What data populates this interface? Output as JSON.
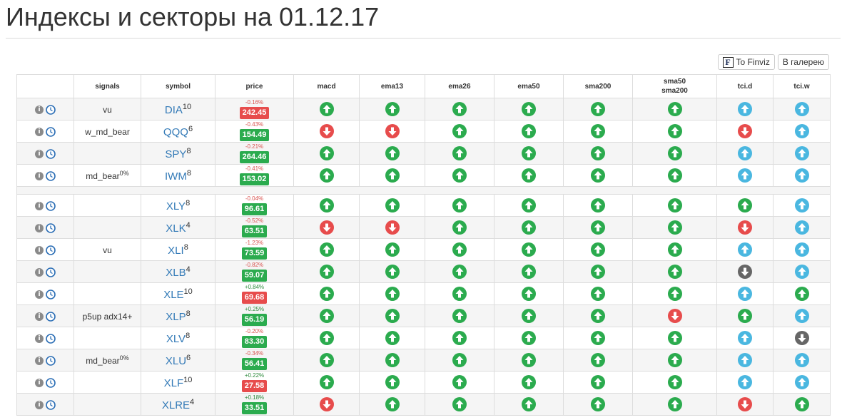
{
  "page": {
    "title": "Индексы и секторы на 01.12.17"
  },
  "toolbar": {
    "finviz_logo": "F",
    "finviz_label": "To Finviz",
    "gallery_label": "В галерею"
  },
  "colors": {
    "green": "#2bab4e",
    "red": "#e74c4c",
    "blue": "#4ab7e0",
    "gray": "#666666"
  },
  "table": {
    "columns": {
      "signals": "signals",
      "symbol": "symbol",
      "price": "price",
      "macd": "macd",
      "ema13": "ema13",
      "ema26": "ema26",
      "ema50": "ema50",
      "sma200": "sma200",
      "sma50_sma200_line1": "sma50",
      "sma50_sma200_line2": "sma200",
      "tci_d": "tci.d",
      "tci_w": "tci.w"
    },
    "groups": [
      {
        "rows": [
          {
            "signal": "vu",
            "signal_sup": "",
            "symbol": "DIA",
            "sup": "10",
            "change": "-0.16%",
            "price": "242.45",
            "price_color": "red",
            "signals": [
              "green-up",
              "green-up",
              "green-up",
              "green-up",
              "green-up",
              "green-up",
              "blue-up",
              "blue-up"
            ]
          },
          {
            "signal": "w_md_bear",
            "signal_sup": "",
            "symbol": "QQQ",
            "sup": "6",
            "change": "-0.43%",
            "price": "154.49",
            "price_color": "green",
            "signals": [
              "red-down",
              "red-down",
              "green-up",
              "green-up",
              "green-up",
              "green-up",
              "red-down",
              "blue-up"
            ]
          },
          {
            "signal": "",
            "signal_sup": "",
            "symbol": "SPY",
            "sup": "8",
            "change": "-0.21%",
            "price": "264.46",
            "price_color": "green",
            "signals": [
              "green-up",
              "green-up",
              "green-up",
              "green-up",
              "green-up",
              "green-up",
              "blue-up",
              "blue-up"
            ]
          },
          {
            "signal": "md_bear",
            "signal_sup": "0%",
            "symbol": "IWM",
            "sup": "8",
            "change": "-0.41%",
            "price": "153.02",
            "price_color": "green",
            "signals": [
              "green-up",
              "green-up",
              "green-up",
              "green-up",
              "green-up",
              "green-up",
              "blue-up",
              "blue-up"
            ]
          }
        ]
      },
      {
        "rows": [
          {
            "signal": "",
            "signal_sup": "",
            "symbol": "XLY",
            "sup": "8",
            "change": "-0.04%",
            "price": "96.61",
            "price_color": "green",
            "signals": [
              "green-up",
              "green-up",
              "green-up",
              "green-up",
              "green-up",
              "green-up",
              "green-up",
              "blue-up"
            ]
          },
          {
            "signal": "",
            "signal_sup": "",
            "symbol": "XLK",
            "sup": "4",
            "change": "-0.52%",
            "price": "63.51",
            "price_color": "green",
            "signals": [
              "red-down",
              "red-down",
              "green-up",
              "green-up",
              "green-up",
              "green-up",
              "red-down",
              "blue-up"
            ]
          },
          {
            "signal": "vu",
            "signal_sup": "",
            "symbol": "XLI",
            "sup": "8",
            "change": "-1.23%",
            "price": "73.59",
            "price_color": "green",
            "signals": [
              "green-up",
              "green-up",
              "green-up",
              "green-up",
              "green-up",
              "green-up",
              "blue-up",
              "blue-up"
            ]
          },
          {
            "signal": "",
            "signal_sup": "",
            "symbol": "XLB",
            "sup": "4",
            "change": "-0.82%",
            "price": "59.07",
            "price_color": "green",
            "signals": [
              "green-up",
              "green-up",
              "green-up",
              "green-up",
              "green-up",
              "green-up",
              "gray-down",
              "blue-up"
            ]
          },
          {
            "signal": "",
            "signal_sup": "",
            "symbol": "XLE",
            "sup": "10",
            "change": "+0.84%",
            "price": "69.68",
            "price_color": "red",
            "signals": [
              "green-up",
              "green-up",
              "green-up",
              "green-up",
              "green-up",
              "green-up",
              "blue-up",
              "green-up"
            ]
          },
          {
            "signal": "p5up adx14+",
            "signal_sup": "",
            "symbol": "XLP",
            "sup": "8",
            "change": "+0.25%",
            "price": "56.19",
            "price_color": "green",
            "signals": [
              "green-up",
              "green-up",
              "green-up",
              "green-up",
              "green-up",
              "red-down",
              "green-up",
              "blue-up"
            ]
          },
          {
            "signal": "",
            "signal_sup": "",
            "symbol": "XLV",
            "sup": "8",
            "change": "-0.20%",
            "price": "83.30",
            "price_color": "green",
            "signals": [
              "green-up",
              "green-up",
              "green-up",
              "green-up",
              "green-up",
              "green-up",
              "blue-up",
              "gray-down"
            ]
          },
          {
            "signal": "md_bear",
            "signal_sup": "0%",
            "symbol": "XLU",
            "sup": "6",
            "change": "-0.34%",
            "price": "56.41",
            "price_color": "green",
            "signals": [
              "green-up",
              "green-up",
              "green-up",
              "green-up",
              "green-up",
              "green-up",
              "blue-up",
              "blue-up"
            ]
          },
          {
            "signal": "",
            "signal_sup": "",
            "symbol": "XLF",
            "sup": "10",
            "change": "+0.22%",
            "price": "27.58",
            "price_color": "red",
            "signals": [
              "green-up",
              "green-up",
              "green-up",
              "green-up",
              "green-up",
              "green-up",
              "blue-up",
              "blue-up"
            ]
          },
          {
            "signal": "",
            "signal_sup": "",
            "symbol": "XLRE",
            "sup": "4",
            "change": "+0.18%",
            "price": "33.51",
            "price_color": "green",
            "signals": [
              "red-down",
              "green-up",
              "green-up",
              "green-up",
              "green-up",
              "green-up",
              "red-down",
              "green-up"
            ]
          }
        ]
      }
    ]
  }
}
